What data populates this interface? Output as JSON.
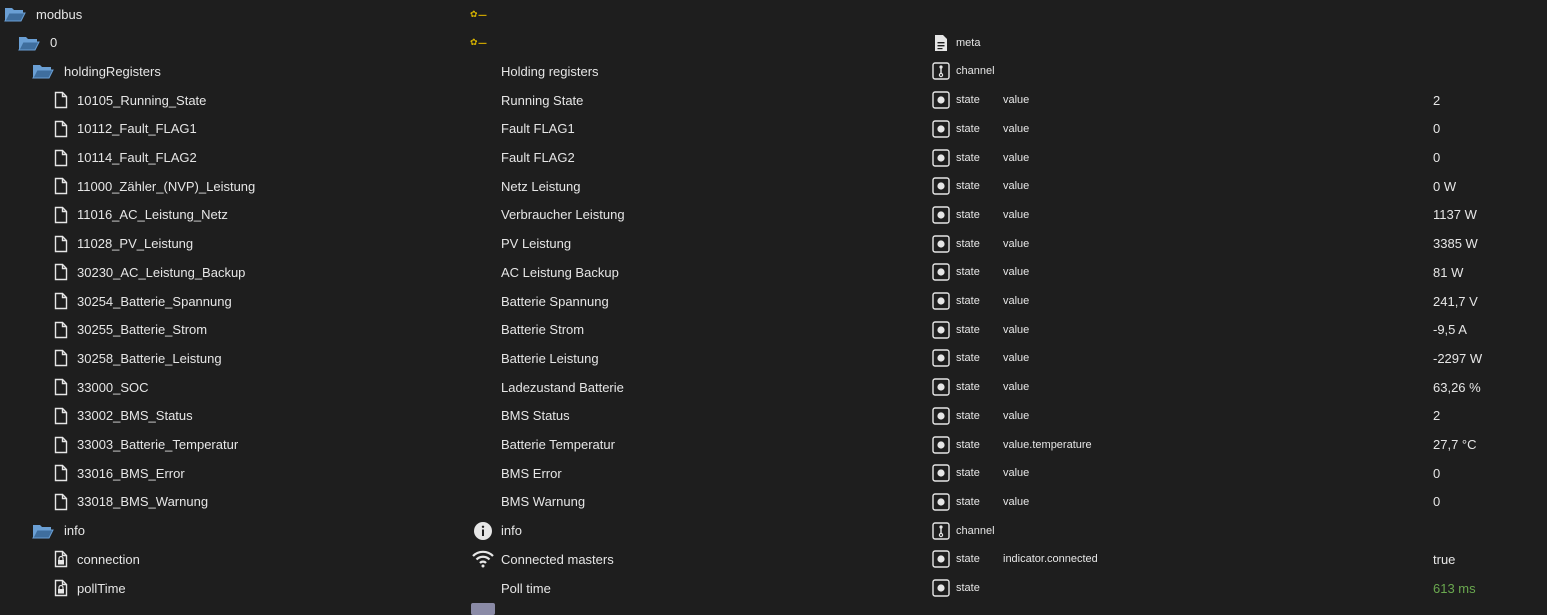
{
  "tree": [
    {
      "level": 0,
      "icon": "folder-open-icon",
      "name": "modbus",
      "desc": "",
      "descIcon": "adapter-logo",
      "typeIcon": "",
      "type": "",
      "role": "",
      "value": ""
    },
    {
      "level": 1,
      "icon": "folder-open-icon",
      "name": "0",
      "desc": "",
      "descIcon": "adapter-logo",
      "typeIcon": "meta-icon",
      "type": "meta",
      "role": "",
      "value": ""
    },
    {
      "level": 2,
      "icon": "folder-open-icon",
      "name": "holdingRegisters",
      "desc": "Holding registers",
      "descIcon": "",
      "typeIcon": "channel-icon",
      "type": "channel",
      "role": "",
      "value": ""
    },
    {
      "level": 3,
      "icon": "file-icon",
      "name": "10105_Running_State",
      "desc": "Running State",
      "descIcon": "",
      "typeIcon": "state-icon",
      "type": "state",
      "role": "value",
      "value": "2"
    },
    {
      "level": 3,
      "icon": "file-icon",
      "name": "10112_Fault_FLAG1",
      "desc": "Fault FLAG1",
      "descIcon": "",
      "typeIcon": "state-icon",
      "type": "state",
      "role": "value",
      "value": "0"
    },
    {
      "level": 3,
      "icon": "file-icon",
      "name": "10114_Fault_FLAG2",
      "desc": "Fault FLAG2",
      "descIcon": "",
      "typeIcon": "state-icon",
      "type": "state",
      "role": "value",
      "value": "0"
    },
    {
      "level": 3,
      "icon": "file-icon",
      "name": "11000_Zähler_(NVP)_Leistung",
      "desc": "Netz Leistung",
      "descIcon": "",
      "typeIcon": "state-icon",
      "type": "state",
      "role": "value",
      "value": "0 W"
    },
    {
      "level": 3,
      "icon": "file-icon",
      "name": "11016_AC_Leistung_Netz",
      "desc": "Verbraucher Leistung",
      "descIcon": "",
      "typeIcon": "state-icon",
      "type": "state",
      "role": "value",
      "value": "1137 W"
    },
    {
      "level": 3,
      "icon": "file-icon",
      "name": "11028_PV_Leistung",
      "desc": "PV Leistung",
      "descIcon": "",
      "typeIcon": "state-icon",
      "type": "state",
      "role": "value",
      "value": "3385 W"
    },
    {
      "level": 3,
      "icon": "file-icon",
      "name": "30230_AC_Leistung_Backup",
      "desc": "AC Leistung Backup",
      "descIcon": "",
      "typeIcon": "state-icon",
      "type": "state",
      "role": "value",
      "value": "81 W"
    },
    {
      "level": 3,
      "icon": "file-icon",
      "name": "30254_Batterie_Spannung",
      "desc": "Batterie Spannung",
      "descIcon": "",
      "typeIcon": "state-icon",
      "type": "state",
      "role": "value",
      "value": "241,7 V"
    },
    {
      "level": 3,
      "icon": "file-icon",
      "name": "30255_Batterie_Strom",
      "desc": "Batterie Strom",
      "descIcon": "",
      "typeIcon": "state-icon",
      "type": "state",
      "role": "value",
      "value": "-9,5 A"
    },
    {
      "level": 3,
      "icon": "file-icon",
      "name": "30258_Batterie_Leistung",
      "desc": "Batterie Leistung",
      "descIcon": "",
      "typeIcon": "state-icon",
      "type": "state",
      "role": "value",
      "value": "-2297 W"
    },
    {
      "level": 3,
      "icon": "file-icon",
      "name": "33000_SOC",
      "desc": "Ladezustand Batterie",
      "descIcon": "",
      "typeIcon": "state-icon",
      "type": "state",
      "role": "value",
      "value": "63,26 %"
    },
    {
      "level": 3,
      "icon": "file-icon",
      "name": "33002_BMS_Status",
      "desc": "BMS Status",
      "descIcon": "",
      "typeIcon": "state-icon",
      "type": "state",
      "role": "value",
      "value": "2"
    },
    {
      "level": 3,
      "icon": "file-icon",
      "name": "33003_Batterie_Temperatur",
      "desc": "Batterie Temperatur",
      "descIcon": "",
      "typeIcon": "state-icon",
      "type": "state",
      "role": "value.temperature",
      "value": "27,7 °C"
    },
    {
      "level": 3,
      "icon": "file-icon",
      "name": "33016_BMS_Error",
      "desc": "BMS Error",
      "descIcon": "",
      "typeIcon": "state-icon",
      "type": "state",
      "role": "value",
      "value": "0"
    },
    {
      "level": 3,
      "icon": "file-icon",
      "name": "33018_BMS_Warnung",
      "desc": "BMS Warnung",
      "descIcon": "",
      "typeIcon": "state-icon",
      "type": "state",
      "role": "value",
      "value": "0"
    },
    {
      "level": 2,
      "icon": "folder-open-icon",
      "name": "info",
      "desc": "info",
      "descIcon": "info-icon",
      "typeIcon": "channel-icon",
      "type": "channel",
      "role": "",
      "value": ""
    },
    {
      "level": 3,
      "icon": "lock-file-icon",
      "name": "connection",
      "desc": "Connected masters",
      "descIcon": "wifi-icon",
      "typeIcon": "state-icon",
      "type": "state",
      "role": "indicator.connected",
      "value": "true"
    },
    {
      "level": 3,
      "icon": "lock-file-icon",
      "name": "pollTime",
      "desc": "Poll time",
      "descIcon": "",
      "typeIcon": "state-icon",
      "type": "state",
      "role": "",
      "value": "613 ms",
      "valueColor": "#6aa84f"
    }
  ],
  "colors": {
    "background": "#1e1e1e",
    "text": "#e6e6e6",
    "folder": "#6a9fd4",
    "ackValue": "#6aa84f"
  }
}
